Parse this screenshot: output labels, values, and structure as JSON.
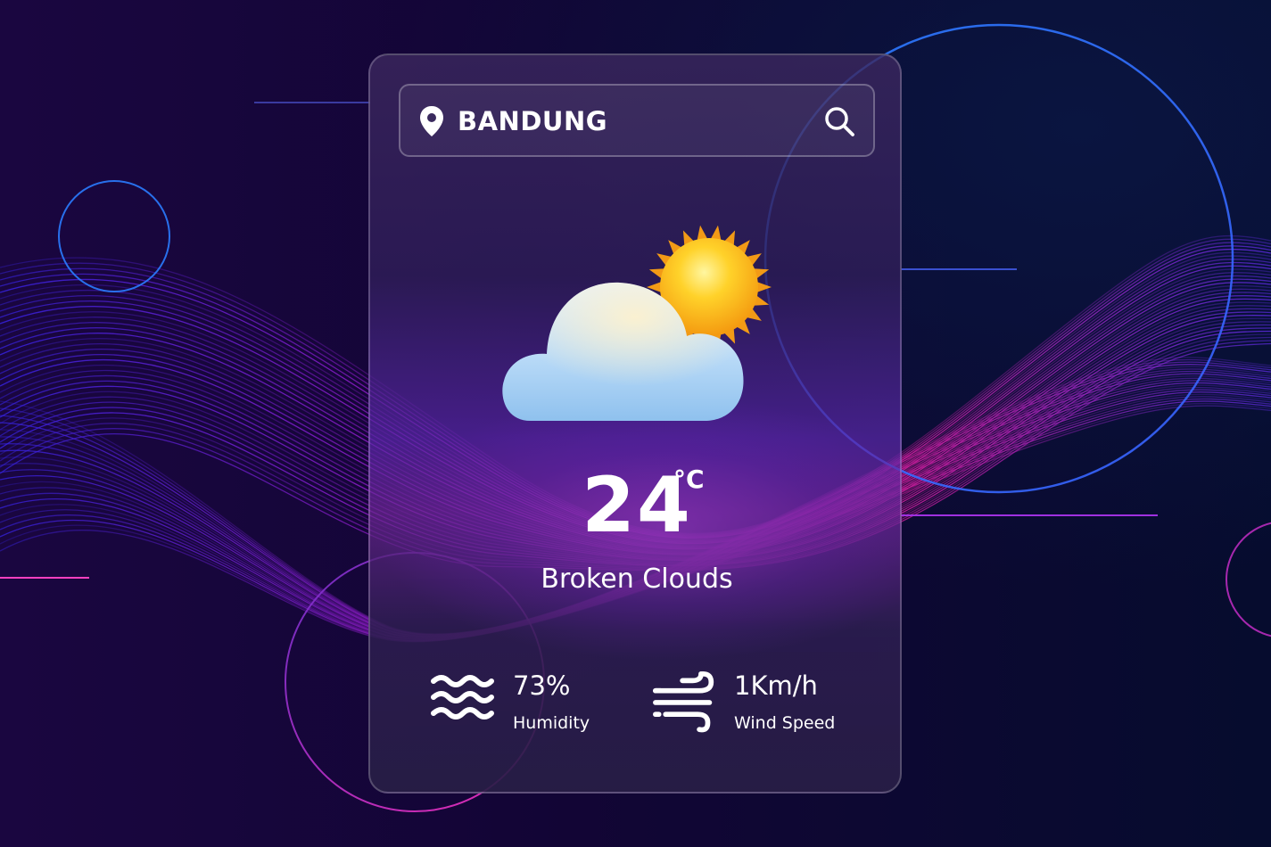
{
  "search": {
    "city": "BANDUNG",
    "icon_location": "location-pin-icon",
    "icon_search": "search-icon"
  },
  "weather": {
    "icon": "partly-cloudy-icon",
    "temperature": "24",
    "unit": "°C",
    "description": "Broken Clouds"
  },
  "details": {
    "humidity": {
      "value": "73%",
      "label": "Humidity",
      "icon": "humidity-waves-icon"
    },
    "wind": {
      "value": "1Km/h",
      "label": "Wind Speed",
      "icon": "wind-icon"
    }
  },
  "colors": {
    "text": "#ffffff",
    "accent_magenta": "#e020c0",
    "accent_blue": "#2a7cff",
    "background": "#0b0628"
  }
}
